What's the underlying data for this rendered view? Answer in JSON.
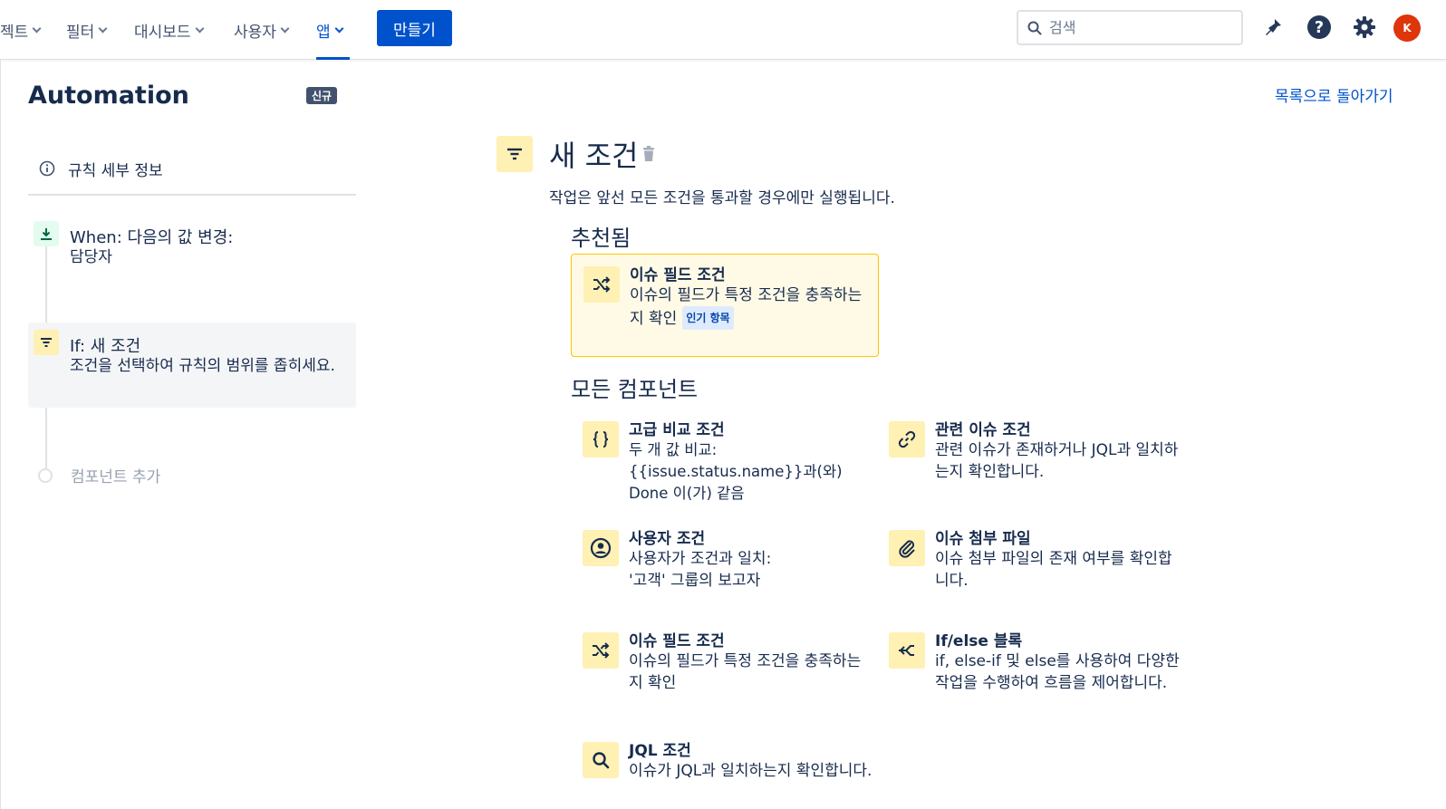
{
  "nav": {
    "items": [
      {
        "label": "젝트"
      },
      {
        "label": "필터"
      },
      {
        "label": "대시보드"
      },
      {
        "label": "사용자"
      },
      {
        "label": "앱"
      }
    ],
    "create_label": "만들기",
    "search_placeholder": "검색",
    "avatar_initial": "K",
    "colors": {
      "primary": "#0052cc",
      "avatar": "#de350b"
    }
  },
  "sidebar": {
    "title": "Automation",
    "badge": "신규",
    "rule_details": "규칙 세부 정보",
    "steps": [
      {
        "title": "When: 다음의 값 변경:",
        "sub": "담당자",
        "icon": "trigger-icon"
      },
      {
        "title": "If: 새 조건",
        "sub": "조건을 선택하여 규칙의 범위를 좁히세요.",
        "icon": "filter-icon"
      }
    ],
    "add_component": "컴포넌트 추가"
  },
  "main": {
    "back_link": "목록으로 돌아가기",
    "title": "새 조건",
    "description": "작업은 앞선 모든 조건을 통과할 경우에만 실행됩니다.",
    "recommended_heading": "추천됨",
    "recommended": {
      "title": "이슈 필드 조건",
      "desc": "이슈의 필드가 특정 조건을 충족하는지 확인",
      "badge": "인기 항목",
      "icon": "shuffle-icon"
    },
    "all_heading": "모든 컴포넌트",
    "components": [
      {
        "title": "고급 비교 조건",
        "desc": "두 개 값 비교:\n{{issue.status.name}}과(와) Done 이(가) 같음",
        "icon": "braces-icon"
      },
      {
        "title": "관련 이슈 조건",
        "desc": "관련 이슈가 존재하거나 JQL과 일치하는지 확인합니다.",
        "icon": "link-icon"
      },
      {
        "title": "사용자 조건",
        "desc": "사용자가 조건과 일치:\n'고객' 그룹의 보고자",
        "icon": "user-circle-icon"
      },
      {
        "title": "이슈 첨부 파일",
        "desc": "이슈 첨부 파일의 존재 여부를 확인합니다.",
        "icon": "paperclip-icon"
      },
      {
        "title": "이슈 필드 조건",
        "desc": "이슈의 필드가 특정 조건을 충족하는지 확인",
        "icon": "shuffle-icon"
      },
      {
        "title": "If/else 블록",
        "desc": "if, else-if 및 else를 사용하여 다양한 작업을 수행하여 흐름을 제어합니다.",
        "icon": "branch-icon"
      },
      {
        "title": "JQL 조건",
        "desc": "이슈가 JQL과 일치하는지 확인합니다.",
        "icon": "search-icon"
      }
    ]
  }
}
